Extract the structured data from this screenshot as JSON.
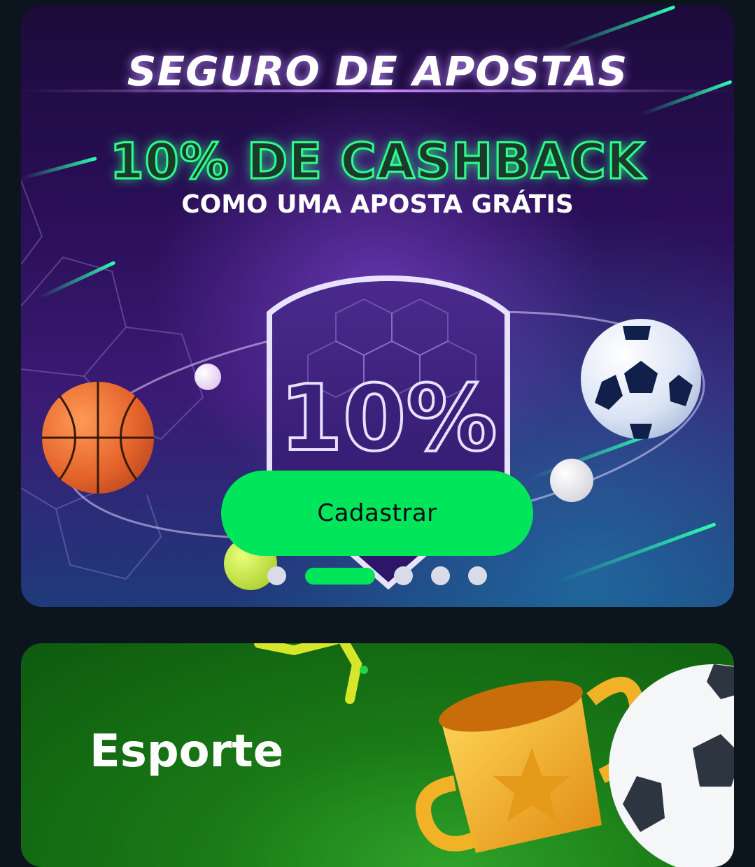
{
  "promo_banner": {
    "headline": "SEGURO DE APOSTAS",
    "offer": "10% DE CASHBACK",
    "subheadline": "COMO UMA APOSTA GRÁTIS",
    "shield_text": "10%",
    "cta_label": "Cadastrar",
    "carousel": {
      "total": 5,
      "active_index": 1
    },
    "colors": {
      "accent": "#00e55a",
      "offer_glow": "#2dff8a"
    }
  },
  "category_card": {
    "title": "Esporte",
    "background": "#1a7a16"
  }
}
